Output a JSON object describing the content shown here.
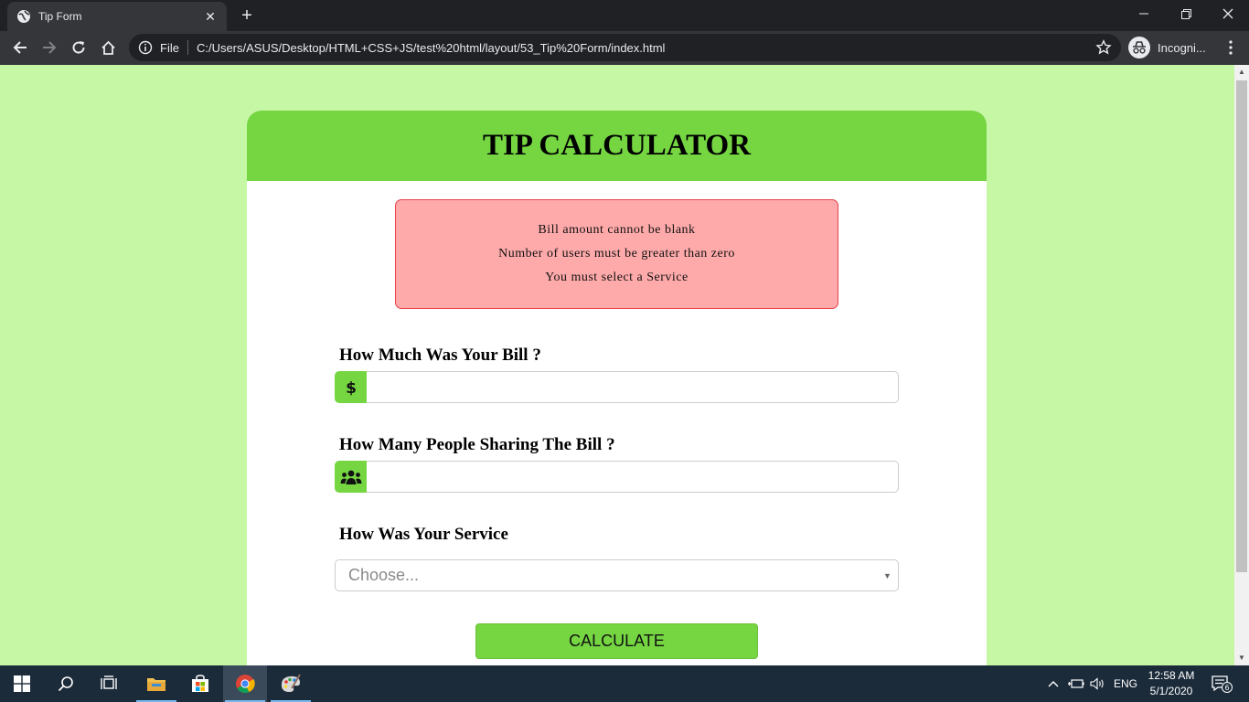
{
  "browser": {
    "tab_title": "Tip Form",
    "omnibox_scheme": "File",
    "url": "C:/Users/ASUS/Desktop/HTML+CSS+JS/test%20html/layout/53_Tip%20Form/index.html",
    "profile_label": "Incogni..."
  },
  "page": {
    "heading": "TIP CALCULATOR",
    "errors": [
      "Bill amount cannot be blank",
      "Number of users must be greater than zero",
      "You must select a Service"
    ],
    "bill_label": "How Much Was Your Bill ?",
    "bill_value": "",
    "people_label": "How Many People Sharing The Bill ?",
    "people_value": "",
    "service_label": "How Was Your Service",
    "service_selected": "Choose...",
    "calculate_label": "CALCULATE"
  },
  "taskbar": {
    "language": "ENG",
    "time": "12:58 AM",
    "date": "5/1/2020",
    "notification_count": "6"
  },
  "colors": {
    "page_background": "#c5f7a5",
    "accent_green": "#75d642",
    "alert_background": "#ffaaaa",
    "alert_border": "#e8414a"
  }
}
